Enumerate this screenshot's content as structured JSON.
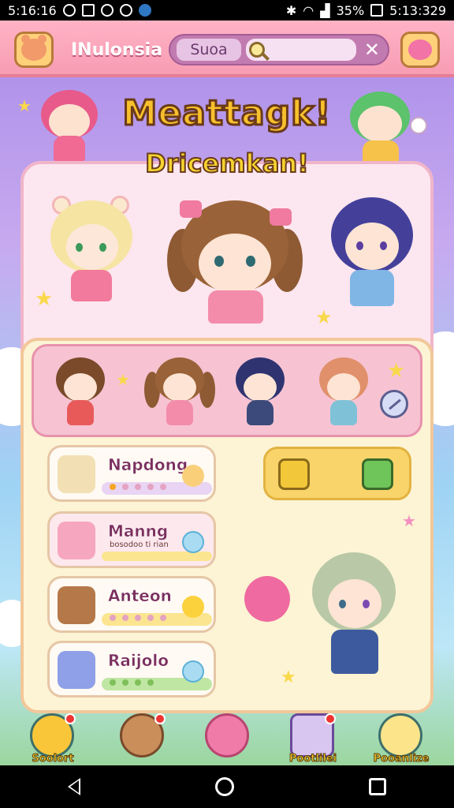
{
  "status_bar": {
    "time": "5:16:16",
    "battery": "35%",
    "clock_right": "5:13:329"
  },
  "top_bar": {
    "region": "INulonsia",
    "search_tab": "Suoa",
    "search_placeholder": "",
    "close_glyph": "✕"
  },
  "title": {
    "main": "Meattagk!",
    "sub": "Dricemkan!"
  },
  "cards": [
    {
      "label": "Napdong",
      "sub": "",
      "icon": "stool-icon",
      "accent": "#e9d4f3"
    },
    {
      "label": "Manng",
      "sub": "bosodoo ti rian",
      "icon": "pig-plush-icon",
      "accent": "#fbe590"
    },
    {
      "label": "Anteon",
      "sub": "",
      "icon": "cake-icon",
      "accent": "#fbe590"
    },
    {
      "label": "Raijolo",
      "sub": "",
      "icon": "jelly-box-icon",
      "accent": "#bfe6a3"
    }
  ],
  "bottom_nav": [
    {
      "label": "Soolort",
      "icon": "home-arrow-icon"
    },
    {
      "label": "",
      "icon": "bear-icon"
    },
    {
      "label": "",
      "icon": "ghost-icon"
    },
    {
      "label": "Pootlilei",
      "icon": "book-stack-icon"
    },
    {
      "label": "Pooanlize",
      "icon": "duck-icon"
    }
  ],
  "colors": {
    "accent_pink": "#f79cb3",
    "title_yellow": "#f8c02c",
    "panel_cream": "#fcf4d4"
  }
}
